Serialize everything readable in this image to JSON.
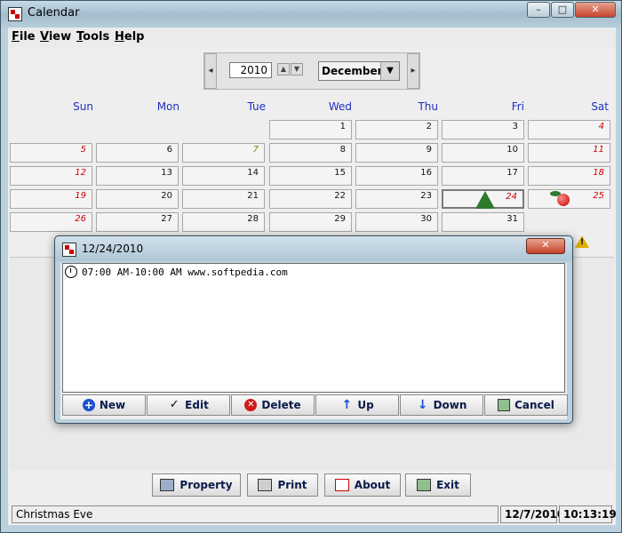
{
  "window": {
    "title": "Calendar",
    "minimize": "–",
    "maximize": "□",
    "close": "✕"
  },
  "menu": [
    {
      "label": "File"
    },
    {
      "label": "View"
    },
    {
      "label": "Tools"
    },
    {
      "label": "Help"
    }
  ],
  "nav": {
    "year": "2010",
    "month": "December",
    "prev": "◂",
    "next": "▸",
    "spin_up": "▲",
    "spin_down": "▼",
    "dropdown": "▼"
  },
  "weekdays": [
    "Sun",
    "Mon",
    "Tue",
    "Wed",
    "Thu",
    "Fri",
    "Sat"
  ],
  "days": [
    "1",
    "2",
    "3",
    "4",
    "5",
    "6",
    "7",
    "8",
    "9",
    "10",
    "11",
    "12",
    "13",
    "14",
    "15",
    "16",
    "17",
    "18",
    "19",
    "20",
    "21",
    "22",
    "23",
    "24",
    "25",
    "26",
    "27",
    "28",
    "29",
    "30",
    "31"
  ],
  "dialog": {
    "title": "12/24/2010",
    "close": "✕",
    "event": "07:00 AM-10:00 AM www.softpedia.com",
    "buttons": {
      "new": "New",
      "edit": "Edit",
      "delete": "Delete",
      "up": "Up",
      "down": "Down",
      "cancel": "Cancel"
    }
  },
  "toolbar": {
    "property": "Property",
    "print": "Print",
    "about": "About",
    "exit": "Exit"
  },
  "status": {
    "holiday": "Christmas Eve",
    "date": "12/7/2010",
    "time": "10:13:19"
  },
  "colors": {
    "weekday_header": "#1f2fbf",
    "weekend_day": "#cc0000",
    "title_accent": "#bcd1de"
  },
  "icons": {
    "warning": "warning-icon",
    "clock": "clock-icon",
    "tree": "christmas-tree-icon",
    "ornament": "ornament-icon"
  }
}
